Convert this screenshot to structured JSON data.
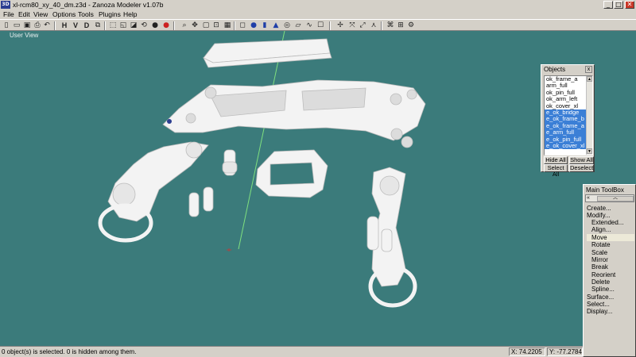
{
  "window": {
    "app_icon": "3D",
    "title": "xl-rcm80_xy_40_dm.z3d - Zanoza Modeler v1.07b",
    "minimize": "_",
    "maximize": "□",
    "close": "✕"
  },
  "menu": [
    "File",
    "Edit",
    "View",
    "Options",
    "Tools",
    "Plugins",
    "Help"
  ],
  "toolbar": {
    "h_label": "H",
    "v_label": "V",
    "d_label": "D",
    "icons": [
      "new-icon",
      "open-icon",
      "save-icon",
      "print-icon",
      "undo-icon",
      "redo-icon",
      "cut-icon",
      "copy-icon",
      "paste-icon",
      "select-icon",
      "select-region-icon",
      "lasso-icon",
      "sphere-icon",
      "zoom-icon",
      "pan-icon",
      "rotate-view-icon",
      "box-icon",
      "cylinder-icon",
      "cone-icon",
      "torus-icon",
      "plane-icon",
      "light-icon",
      "camera-icon",
      "grid-icon",
      "move-icon",
      "rotate-icon",
      "scale-icon",
      "mirror-icon",
      "render-icon"
    ],
    "accent_red": "#cc2222"
  },
  "viewport": {
    "label": "User View",
    "background": "#3b7b7b"
  },
  "objects_panel": {
    "title": "Objects",
    "close": "x",
    "items": [
      {
        "label": "ok_frame_a",
        "selected": false
      },
      {
        "label": "arm_full",
        "selected": false
      },
      {
        "label": "ok_pin_full",
        "selected": false
      },
      {
        "label": "ok_arm_left",
        "selected": false
      },
      {
        "label": "ok_cover_xl",
        "selected": false
      },
      {
        "label": "e_ok_bridge",
        "selected": true
      },
      {
        "label": "e_ok_frame_b",
        "selected": true
      },
      {
        "label": "e_ok_frame_a",
        "selected": true
      },
      {
        "label": "e_arm_full",
        "selected": true
      },
      {
        "label": "e_ok_pin_full",
        "selected": true
      },
      {
        "label": "e_ok_cover_xl",
        "selected": true
      }
    ],
    "buttons": {
      "hide_all": "Hide All",
      "show_all": "Show All",
      "select_all": "Select All",
      "deselect": "Deselect"
    }
  },
  "toolbox": {
    "title": "Main ToolBox",
    "back": "«",
    "up": "︿",
    "items": [
      {
        "label": "Create...",
        "indent": 0,
        "active": false
      },
      {
        "label": "Modify...",
        "indent": 0,
        "active": false
      },
      {
        "label": "Extended...",
        "indent": 1,
        "active": false
      },
      {
        "label": "Align...",
        "indent": 1,
        "active": false
      },
      {
        "label": "Move",
        "indent": 1,
        "active": true
      },
      {
        "label": "Rotate",
        "indent": 1,
        "active": false
      },
      {
        "label": "Scale",
        "indent": 1,
        "active": false
      },
      {
        "label": "Mirror",
        "indent": 1,
        "active": false
      },
      {
        "label": "Break",
        "indent": 1,
        "active": false
      },
      {
        "label": "Reorient",
        "indent": 1,
        "active": false
      },
      {
        "label": "Delete",
        "indent": 1,
        "active": false
      },
      {
        "label": "Spline...",
        "indent": 1,
        "active": false
      },
      {
        "label": "Surface...",
        "indent": 0,
        "active": false
      },
      {
        "label": "Select...",
        "indent": 0,
        "active": false
      },
      {
        "label": "Display...",
        "indent": 0,
        "active": false
      }
    ]
  },
  "status": {
    "message": "0 object(s) is selected. 0 is hidden among them.",
    "x": "X: 74.2205",
    "y": "Y: -77.2784"
  }
}
